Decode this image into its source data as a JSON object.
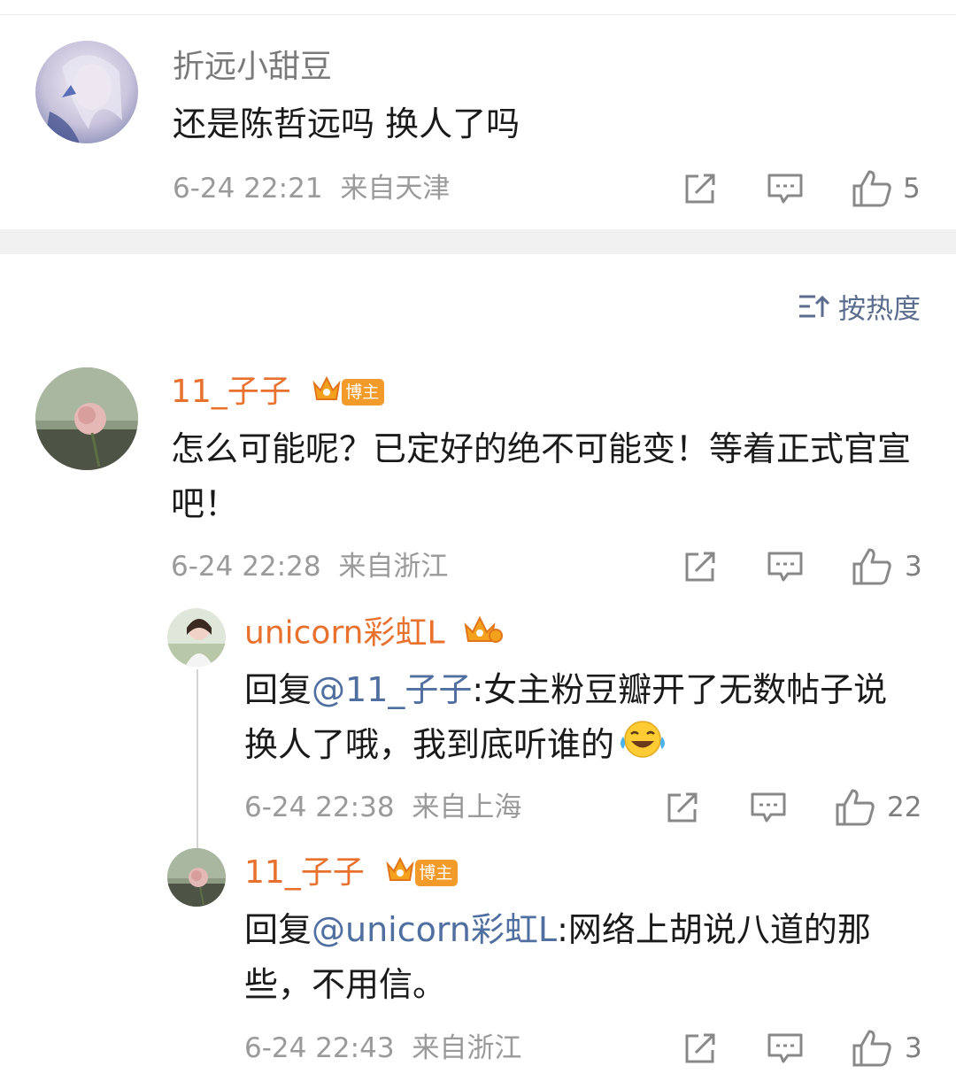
{
  "comments": [
    {
      "username": "折远小甜豆",
      "text": "还是陈哲远吗 换人了吗",
      "time": "6-24 22:21",
      "location": "来自天津",
      "likes": "5"
    },
    {
      "username": "11_子子",
      "badge": "博主",
      "text": "怎么可能呢？已定好的绝不可能变！等着正式官宣吧！",
      "time": "6-24 22:28",
      "location": "来自浙江",
      "likes": "3"
    }
  ],
  "sort_label": "按热度",
  "replies": [
    {
      "username": "unicorn彩虹L",
      "reply_prefix": "回复",
      "mention": "@11_子子",
      "text": ":女主粉豆瓣开了无数帖子说换人了哦，我到底听谁的",
      "emoji": "laugh-cry",
      "time": "6-24 22:38",
      "location": "来自上海",
      "likes": "22"
    },
    {
      "username": "11_子子",
      "badge": "博主",
      "reply_prefix": "回复",
      "mention": "@unicorn彩虹L",
      "text": ":网络上胡说八道的那些，不用信。",
      "time": "6-24 22:43",
      "location": "来自浙江",
      "likes": "3"
    }
  ],
  "icons": [
    "share-icon",
    "comment-icon",
    "like-icon",
    "sort-icon",
    "crown-icon"
  ],
  "colors": {
    "username_orange": "#e8712e",
    "mention_blue": "#4f6fa0",
    "meta_gray": "#9a9a9a",
    "badge_orange": "#f39b2a"
  }
}
